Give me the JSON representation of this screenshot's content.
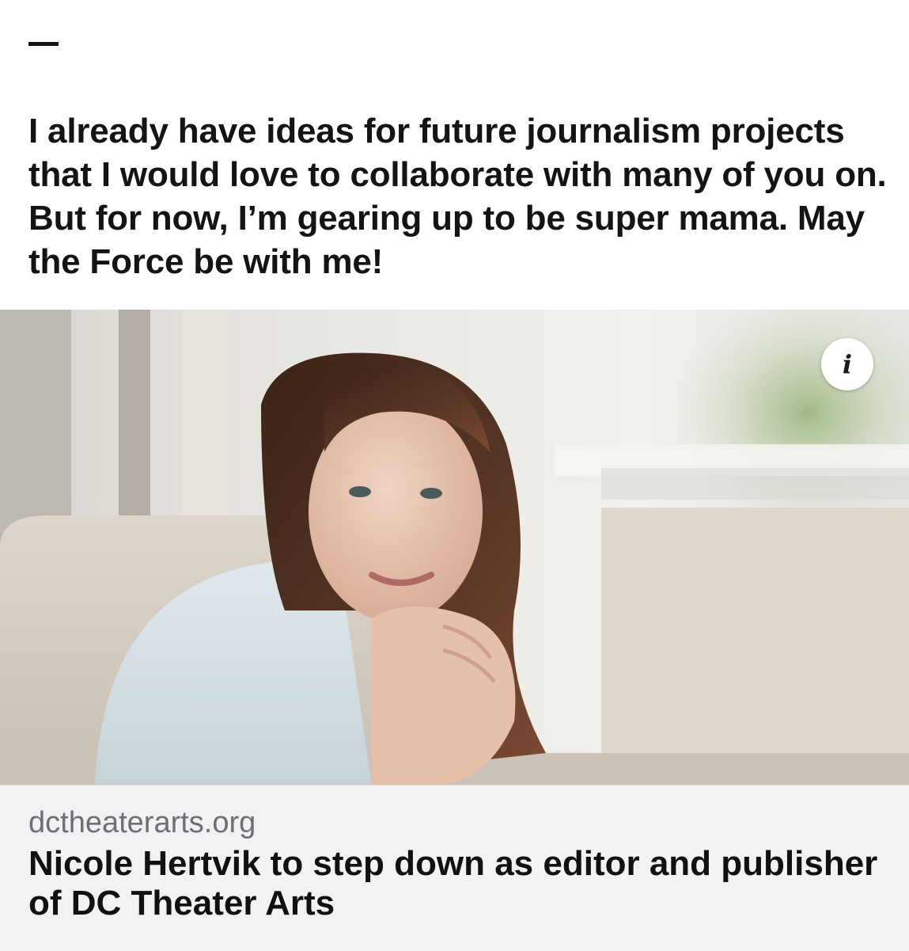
{
  "post": {
    "body_text": "I already have ideas for future journalism projects that I would love to collaborate with many of you on. But for now, I’m gearing up to be super mama. May the Force be with me!"
  },
  "link_card": {
    "info_icon_glyph": "i",
    "domain": "dctheaterarts.org",
    "headline": "Nicole Hertvik to step down as editor and publisher of DC Theater Arts",
    "footer_background": "#f2f2f4"
  }
}
